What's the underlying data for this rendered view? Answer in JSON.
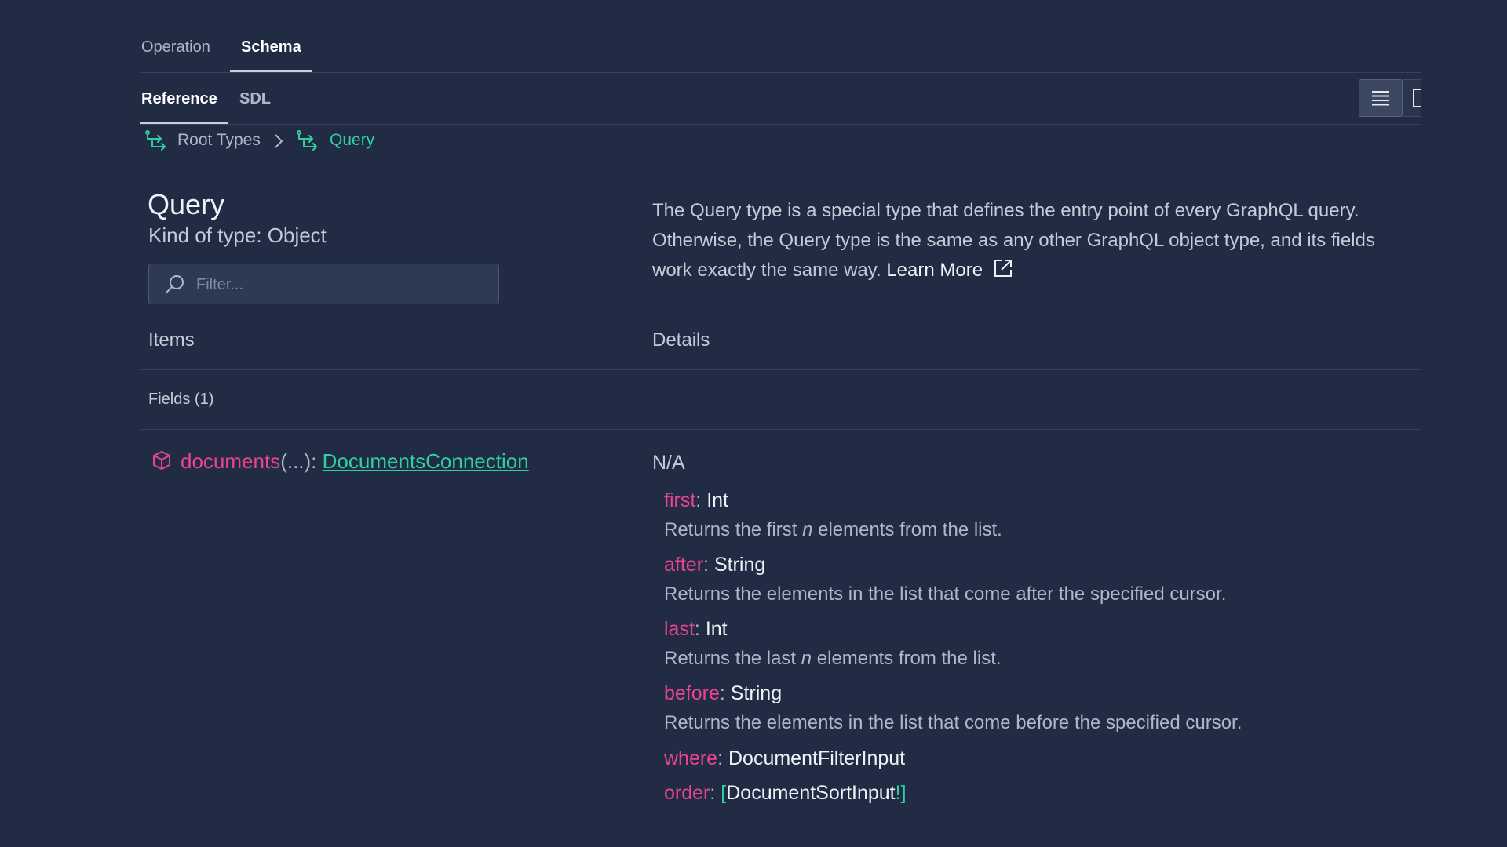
{
  "top_tabs": {
    "operation": "Operation",
    "schema": "Schema"
  },
  "sub_tabs": {
    "reference": "Reference",
    "sdl": "SDL"
  },
  "breadcrumb": {
    "root": "Root Types",
    "current": "Query"
  },
  "type_info": {
    "name": "Query",
    "kind": "Kind of type: Object",
    "description": "The Query type is a special type that defines the entry point of every GraphQL query. Otherwise, the Query type is the same as any other GraphQL object type, and its fields work exactly the same way.",
    "learn_more": "Learn More"
  },
  "filter": {
    "placeholder": "Filter...",
    "value": ""
  },
  "columns": {
    "items": "Items",
    "details": "Details"
  },
  "fields_header": "Fields (1)",
  "field": {
    "name": "documents",
    "args": "(...): ",
    "type": "DocumentsConnection",
    "details": "N/A"
  },
  "arguments": [
    {
      "name": "first",
      "type": "Int",
      "desc_pre": "Returns the first ",
      "desc_em": "n",
      "desc_post": " elements from the list."
    },
    {
      "name": "after",
      "type": "String",
      "desc": "Returns the elements in the list that come after the specified cursor."
    },
    {
      "name": "last",
      "type": "Int",
      "desc_pre": "Returns the last ",
      "desc_em": "n",
      "desc_post": " elements from the list."
    },
    {
      "name": "before",
      "type": "String",
      "desc": "Returns the elements in the list that come before the specified cursor."
    },
    {
      "name": "where",
      "type": "DocumentFilterInput"
    },
    {
      "name": "order",
      "type_open": "[",
      "type": "DocumentSortInput",
      "type_close": "!]"
    }
  ],
  "colors": {
    "background": "#212c44",
    "accent_green": "#2fd0a0",
    "accent_pink": "#e8458d"
  },
  "icons": {
    "breadcrumb": "root-types-icon",
    "field": "cube-icon",
    "search": "search-icon",
    "external": "external-link-icon",
    "view_list": "list-view-icon",
    "view_column": "column-view-icon"
  }
}
